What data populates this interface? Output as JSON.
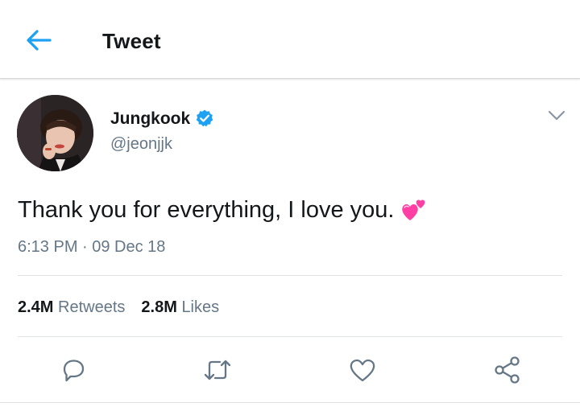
{
  "header": {
    "title": "Tweet",
    "back_icon": "arrow-left-icon"
  },
  "author": {
    "name": "Jungkook",
    "handle": "@jeonjjk",
    "verified_icon": "verified-badge-icon",
    "menu_icon": "chevron-down-icon"
  },
  "tweet": {
    "text": "Thank you for everything, I love you.",
    "emoji": "two-hearts-emoji",
    "timestamp": "6:13 PM · 09 Dec 18"
  },
  "stats": {
    "retweets_count": "2.4M",
    "retweets_label": "Retweets",
    "likes_count": "2.8M",
    "likes_label": "Likes"
  },
  "actions": [
    {
      "icon": "reply-icon"
    },
    {
      "icon": "retweet-icon"
    },
    {
      "icon": "heart-icon"
    },
    {
      "icon": "share-icon"
    }
  ],
  "colors": {
    "accent": "#1da1f2",
    "text_primary": "#14171a",
    "text_secondary": "#657786",
    "divider": "#dfe3e6",
    "hearts": "#ff3fa4"
  }
}
